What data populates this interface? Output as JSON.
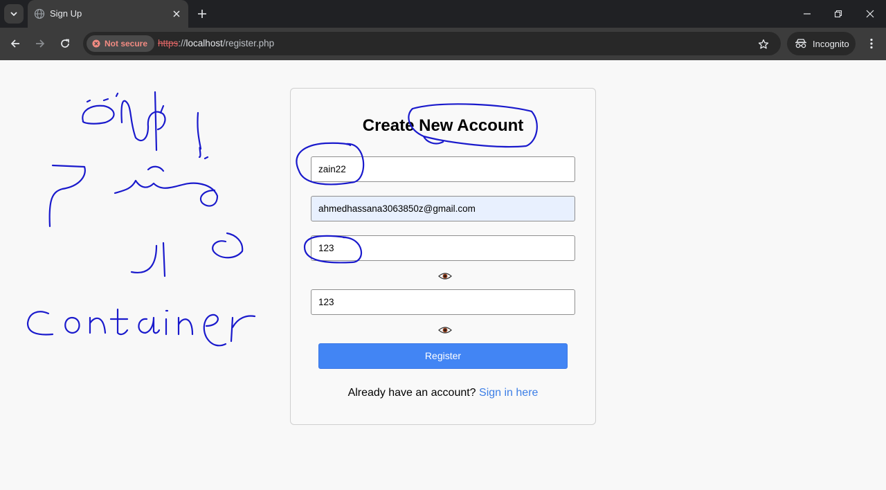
{
  "browser": {
    "tab_title": "Sign Up",
    "security_label": "Not secure",
    "url_scheme": "https",
    "url_separator": "://",
    "url_host": "localhost",
    "url_path": "/register.php",
    "incognito_label": "Incognito"
  },
  "icons": {
    "tab_search": "chevron-down-icon",
    "favicon": "globe-icon",
    "tab_close": "close-icon",
    "new_tab": "plus-icon",
    "minimize": "minimize-icon",
    "restore": "restore-icon",
    "window_close": "close-icon",
    "back": "arrow-left-icon",
    "forward": "arrow-right-icon",
    "reload": "reload-icon",
    "not_secure": "warning-icon",
    "bookmark": "star-icon",
    "incognito": "incognito-icon",
    "menu": "kebab-menu-icon",
    "password_toggle": "eye-icon"
  },
  "form": {
    "title": "Create New Account",
    "username_value": "zain22",
    "email_value": "ahmedhassana3063850z@gmail.com",
    "password_value": "123",
    "confirm_password_value": "123",
    "register_label": "Register",
    "signin_prompt": "Already have an account?",
    "signin_link": "Sign in here"
  },
  "colors": {
    "primary_button": "#4285f4",
    "link": "#3c7ee6",
    "autofill_background": "#e8f0fe",
    "annotation_ink": "#1a1acc"
  }
}
